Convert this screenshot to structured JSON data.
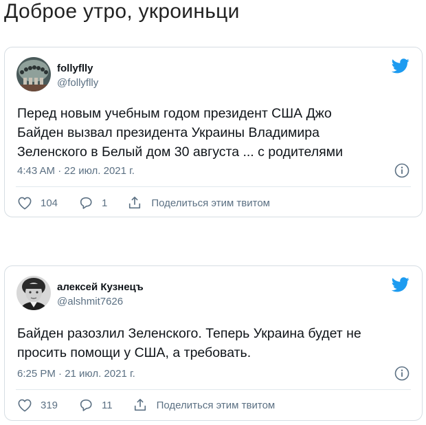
{
  "page": {
    "title": "Доброе утро, укроиньци"
  },
  "tweets": [
    {
      "name": "follyflly",
      "handle": "@follyflly",
      "text_lines": [
        "Перед новым учебным годом президент США Джо",
        "Байден вызвал президента Украины Владимира",
        "Зеленского в Белый дом 30 августа ... с родителями"
      ],
      "time": "4:43 AM · 22 июл. 2021 г.",
      "likes": "104",
      "replies": "1",
      "share_label": "Поделиться этим твитом",
      "avatar_icon": "avatar-crowd-image",
      "brand_icon": "twitter-bird-icon"
    },
    {
      "name": "алексей Кузнецъ",
      "handle": "@alshmit7626",
      "text_lines": [
        "Байден разозлил Зеленского. Теперь Украина будет не",
        "просить помощи у США, а требовать."
      ],
      "time": "6:25 PM · 21 июл. 2021 г.",
      "likes": "319",
      "replies": "11",
      "share_label": "Поделиться этим твитом",
      "avatar_icon": "avatar-boy-photo",
      "brand_icon": "twitter-bird-icon"
    }
  ],
  "colors": {
    "twitter_blue": "#1d9bf0",
    "secondary_text": "#5b7083",
    "border": "#d6dde3"
  }
}
